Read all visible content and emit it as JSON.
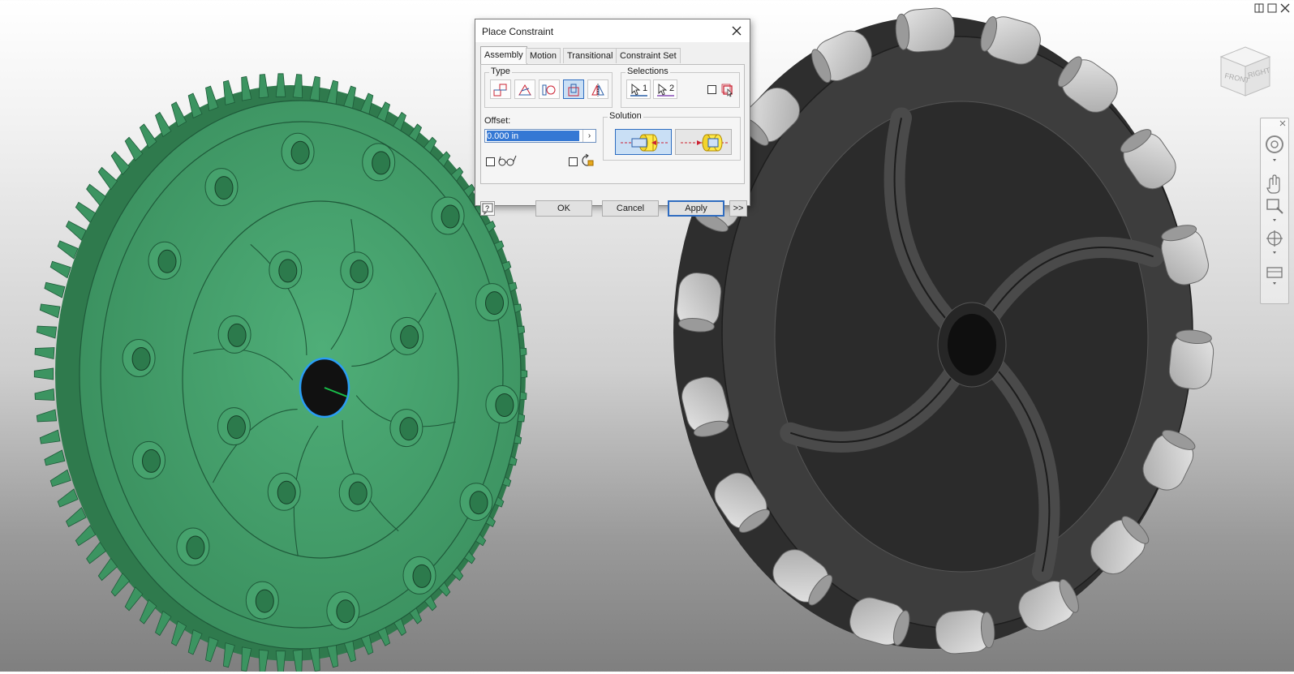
{
  "dialog": {
    "title": "Place Constraint",
    "tabs": [
      {
        "label": "Assembly",
        "active": true
      },
      {
        "label": "Motion",
        "active": false
      },
      {
        "label": "Transitional",
        "active": false
      },
      {
        "label": "Constraint Set",
        "active": false
      }
    ],
    "type_label": "Type",
    "type_buttons": [
      {
        "icon": "mate-icon",
        "active": false
      },
      {
        "icon": "angle-icon",
        "active": false
      },
      {
        "icon": "tangent-icon",
        "active": false
      },
      {
        "icon": "insert-icon",
        "active": true
      },
      {
        "icon": "symmetry-icon",
        "active": false
      }
    ],
    "selections_label": "Selections",
    "select1_label": "1",
    "select2_label": "2",
    "offset_label": "Offset:",
    "offset_value": "0.000 in",
    "solution_label": "Solution",
    "solution_buttons": [
      {
        "icon": "opposed-solution-icon",
        "active": true
      },
      {
        "icon": "aligned-solution-icon",
        "active": false
      }
    ],
    "ok_label": "OK",
    "cancel_label": "Cancel",
    "apply_label": "Apply",
    "more_label": ">>"
  },
  "viewcube": {
    "front_label": "FRONT",
    "right_label": "RIGHT"
  },
  "colors": {
    "gear": "#3f9a66",
    "wheel": "#3b3b3b",
    "roller": "#c8c8c8",
    "accent": "#2f6cc0"
  }
}
